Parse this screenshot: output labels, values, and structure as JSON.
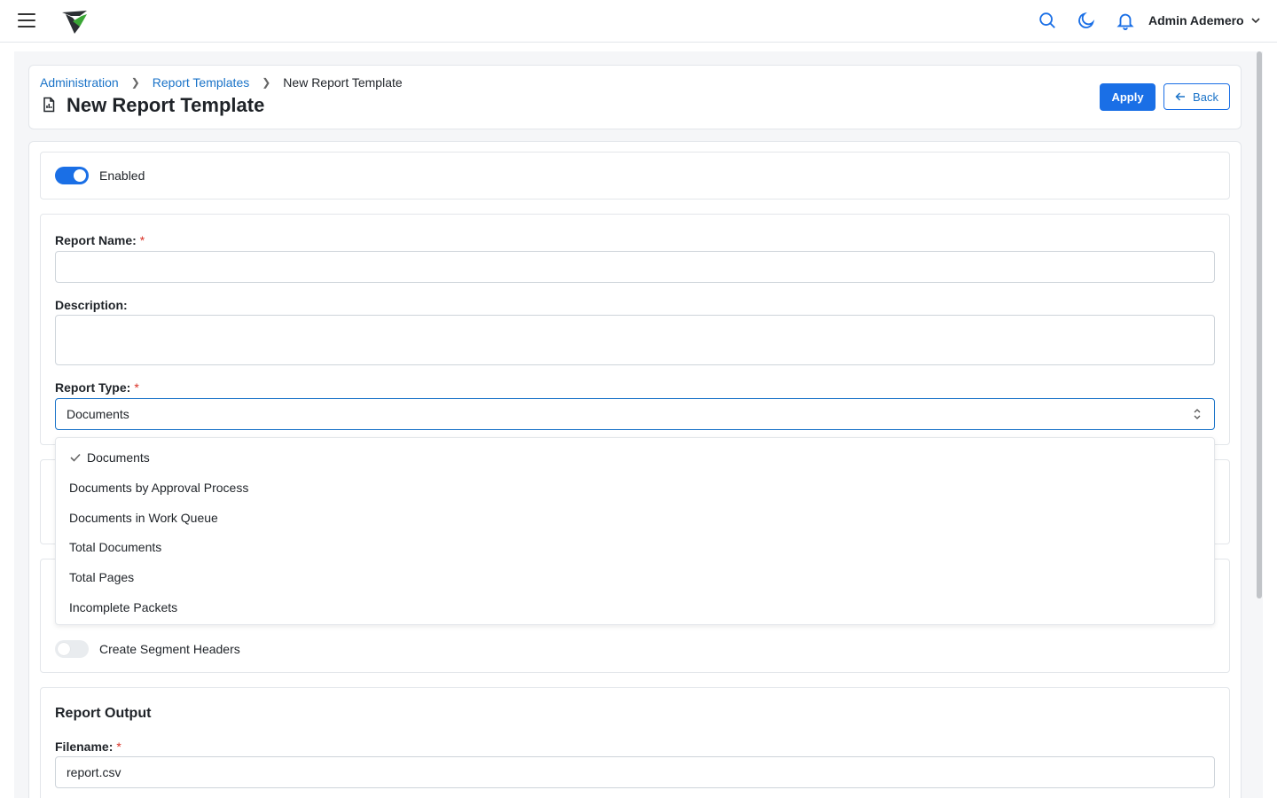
{
  "topbar": {
    "menu_icon": "hamburger-icon",
    "logo": "app-logo",
    "search_icon": "search-icon",
    "theme_icon": "moon-icon",
    "notifications_icon": "bell-icon",
    "user_name": "Admin Ademero"
  },
  "header": {
    "breadcrumb": [
      "Administration",
      "Report Templates",
      "New Report Template"
    ],
    "title": "New Report Template",
    "apply_label": "Apply",
    "back_label": "Back"
  },
  "form": {
    "enabled_label": "Enabled",
    "enabled": true,
    "report_name_label": "Report Name:",
    "report_name_value": "",
    "description_label": "Description:",
    "description_value": "",
    "report_type_label": "Report Type:",
    "report_type_value": "Documents",
    "required_mark": "*",
    "report_type_options": [
      "Documents",
      "Documents by Approval Process",
      "Documents in Work Queue",
      "Total Documents",
      "Total Pages",
      "Incomplete Packets"
    ],
    "create_segment_headers_label": "Create Segment Headers",
    "create_segment_headers": false,
    "report_output_title": "Report Output",
    "filename_label": "Filename:",
    "filename_value": "report.csv"
  },
  "colors": {
    "primary": "#1a6fe6",
    "link": "#1a73c8",
    "required": "#d93025"
  }
}
